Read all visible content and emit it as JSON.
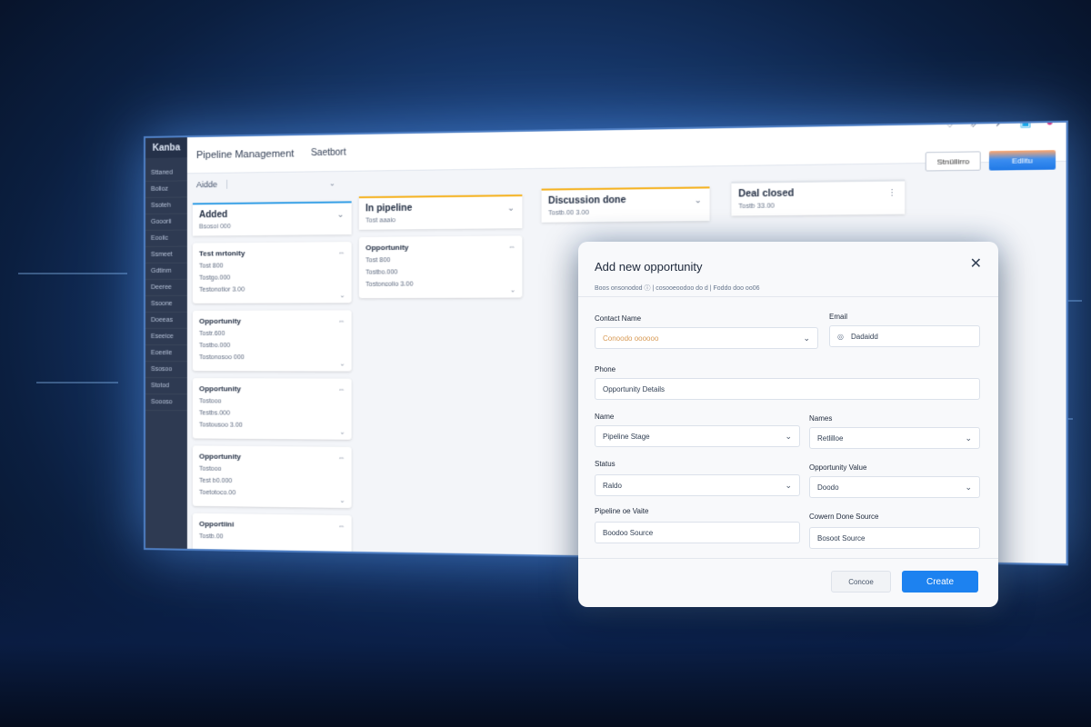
{
  "app": {
    "logo": "Kanba",
    "title": "Pipeline Management",
    "breadcrumb": "Saetbort",
    "secondary_button": "Stnüllirro",
    "primary_button": "Edlitu",
    "tab": "Aidde"
  },
  "sidebar": {
    "items": [
      "Sttaned",
      "Bolioz",
      "Ssoteh",
      "Gooorii",
      "Eooiic",
      "Ssmeet",
      "Gdtinm",
      "Deeree",
      "Ssoone",
      "Doeeas",
      "Eseeice",
      "Eoeeiie",
      "Ssosoo",
      "Stotod",
      "Soooso"
    ]
  },
  "board": {
    "columns": [
      {
        "name": "Added",
        "sub": "Bsosoi 000",
        "cards": [
          {
            "title": "Test mrtonity",
            "lines": [
              "Tost 800",
              "Tostgo.000",
              "Testonotior 3.00"
            ]
          },
          {
            "title": "Opportunity",
            "lines": [
              "Tostr.600",
              "Tostbo.000",
              "Tostonosoo 000"
            ]
          },
          {
            "title": "Opportunity",
            "lines": [
              "Tostooo",
              "Testbs.000",
              "Tostousoo 3.00"
            ]
          },
          {
            "title": "Opportunity",
            "lines": [
              "Tostooo",
              "Test b0.000",
              "Toetotoco.00"
            ]
          },
          {
            "title": "Opportiini",
            "lines": [
              "Tostb.00"
            ]
          }
        ]
      },
      {
        "name": "In pipeline",
        "sub": "Tost aaaio",
        "cards": [
          {
            "title": "Opportunity",
            "lines": [
              "Tost 800",
              "Tostbo.000",
              "Tostoncolio 3.00"
            ]
          }
        ]
      },
      {
        "name": "Discussion done",
        "sub": "Tostb.00 3.00",
        "cards": []
      },
      {
        "name": "Deal closed",
        "sub": "Tostb 33.00",
        "cards": []
      }
    ]
  },
  "modal": {
    "title": "Add new opportunity",
    "meta": "Boos onsonodod ⓘ  |  cosooeoodoo do d  |  Foddo doo oo06",
    "fields": {
      "contact_name": {
        "label": "Contact Name",
        "value": "Conoodo oooooo"
      },
      "email": {
        "label": "Email",
        "value": "Dadaidd"
      },
      "phone": {
        "label": "Phone",
        "value": "Opportunity Details"
      },
      "name": {
        "label": "Name",
        "value": "Pipeline Stage"
      },
      "names": {
        "label": "Names",
        "value": "Retlilloe"
      },
      "status": {
        "label": "Status",
        "value": "Raldo"
      },
      "opportunity_value": {
        "label": "Opportunity Value",
        "value": "Doodo"
      },
      "pipeline_value": {
        "label": "Pipeline oe Vaite",
        "value": "Boodoo Source"
      },
      "source": {
        "label": "Cowern Done Source",
        "value": "Bosoot Source"
      }
    },
    "cancel": "Concoe",
    "create": "Create"
  }
}
